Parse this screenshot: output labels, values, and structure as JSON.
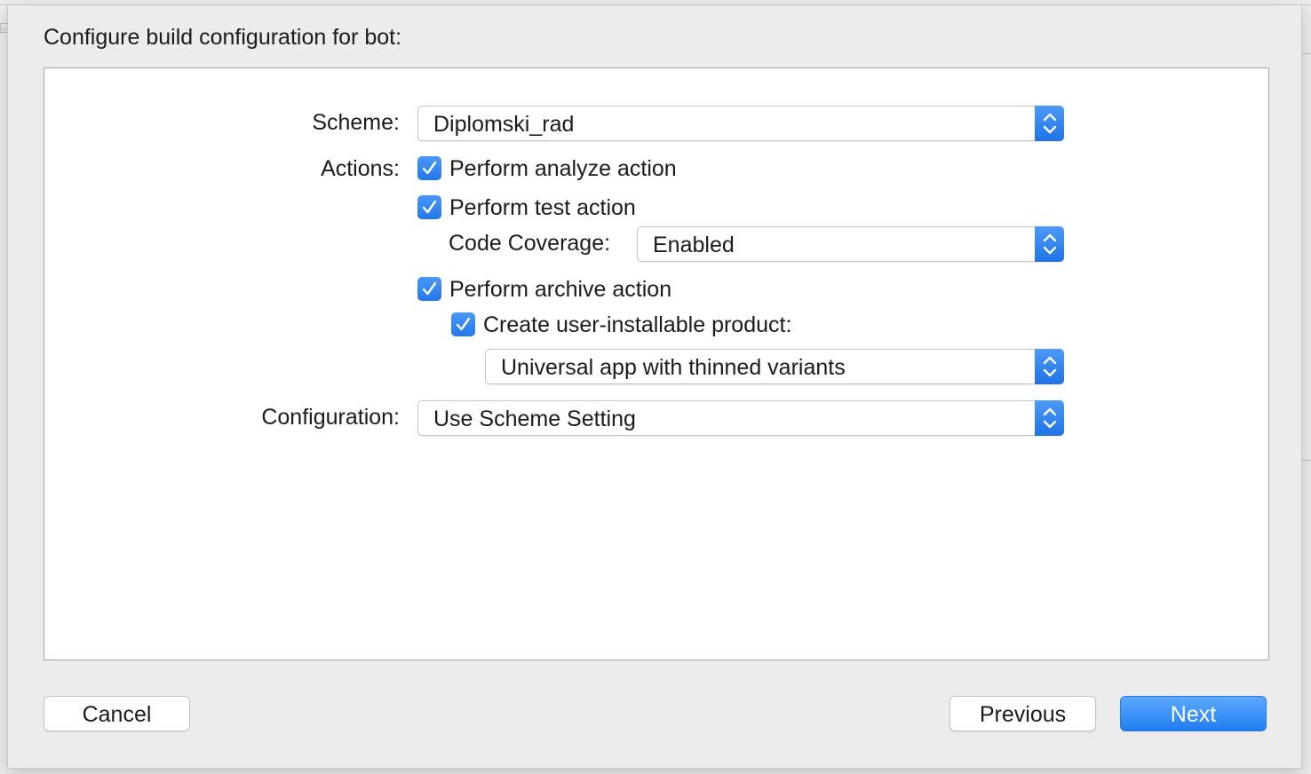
{
  "dialog": {
    "title": "Configure build configuration for bot:"
  },
  "scheme": {
    "label": "Scheme:",
    "value": "Diplomski_rad"
  },
  "actions": {
    "label": "Actions:",
    "analyze": {
      "label": "Perform analyze action",
      "checked": true
    },
    "test": {
      "label": "Perform test action",
      "checked": true
    },
    "code_coverage": {
      "label": "Code Coverage:",
      "value": "Enabled"
    },
    "archive": {
      "label": "Perform archive action",
      "checked": true
    },
    "user_installable": {
      "label": "Create user-installable product:",
      "checked": true
    },
    "product_type": {
      "value": "Universal app with thinned variants"
    }
  },
  "configuration": {
    "label": "Configuration:",
    "value": "Use Scheme Setting"
  },
  "buttons": {
    "cancel": "Cancel",
    "previous": "Previous",
    "next": "Next"
  },
  "colors": {
    "accent": "#2378e8",
    "sheet_bg": "#ececec",
    "content_bg": "#ffffff"
  },
  "icons": {
    "checkbox": "checkmark-icon",
    "popup": "chevron-up-down-icon"
  }
}
